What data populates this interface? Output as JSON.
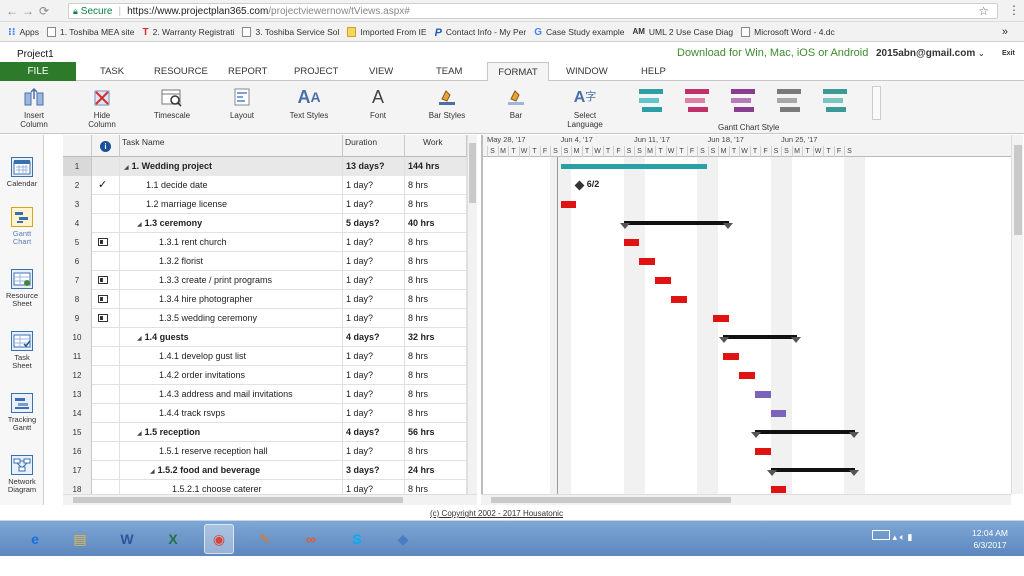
{
  "browser": {
    "secure_label": "Secure",
    "url_domain": "https://www.projectplan365.com",
    "url_path": "/projectviewernow/tViews.aspx#",
    "bookmarks": [
      {
        "label": "Apps",
        "icon": "apps-grid-icon"
      },
      {
        "label": "1. Toshiba MEA site",
        "icon": "page-icon"
      },
      {
        "label": "2. Warranty Registrati",
        "icon": "t-logo-icon"
      },
      {
        "label": "3. Toshiba Service Sol",
        "icon": "page-icon"
      },
      {
        "label": "Imported From IE",
        "icon": "folder-icon"
      },
      {
        "label": "Contact Info - My Per",
        "icon": "p-logo-icon"
      },
      {
        "label": "Case Study example",
        "icon": "google-icon"
      },
      {
        "label": "UML 2 Use Case Diag",
        "icon": "am-logo-icon"
      },
      {
        "label": "Microsoft Word - 4.dc",
        "icon": "page-icon"
      }
    ],
    "more_label": "»"
  },
  "app": {
    "project_title": "Project1",
    "download_text": "Download for Win, Mac, iOS or Android",
    "user_email": "2015abn@gmail.com",
    "exit_label": "Exit"
  },
  "menu": {
    "file": "FILE",
    "items": [
      "TASK",
      "RESOURCE",
      "REPORT",
      "PROJECT",
      "VIEW",
      "TEAM"
    ],
    "format": "FORMAT",
    "items2": [
      "WINDOW",
      "HELP"
    ]
  },
  "ribbon": {
    "buttons": [
      {
        "label": "Insert\nColumn",
        "icon": "insert-column-icon"
      },
      {
        "label": "Hide\nColumn",
        "icon": "hide-column-icon"
      },
      {
        "label": "Timescale",
        "icon": "timescale-icon"
      },
      {
        "label": "Layout",
        "icon": "layout-icon"
      },
      {
        "label": "Text Styles",
        "icon": "text-styles-icon"
      },
      {
        "label": "Font",
        "icon": "font-icon"
      },
      {
        "label": "Bar Styles",
        "icon": "bar-styles-icon"
      },
      {
        "label": "Bar",
        "icon": "bar-icon"
      },
      {
        "label": "Select\nLanguage",
        "icon": "language-icon"
      }
    ],
    "gantt_style_label": "Gantt Chart Style",
    "style_colors": [
      "#2aa0a6",
      "#c0306a",
      "#8a3c8e",
      "#7a7a7a",
      "#3a9a96"
    ]
  },
  "sidebar": [
    {
      "label": "Calendar",
      "icon": "calendar-icon"
    },
    {
      "label": "Gantt\nChart",
      "icon": "gantt-chart-icon"
    },
    {
      "label": "Resource\nSheet",
      "icon": "resource-sheet-icon"
    },
    {
      "label": "Task\nSheet",
      "icon": "task-sheet-icon"
    },
    {
      "label": "Tracking\nGantt",
      "icon": "tracking-gantt-icon"
    },
    {
      "label": "Network\nDiagram",
      "icon": "network-diagram-icon"
    }
  ],
  "grid": {
    "columns": {
      "info": "i",
      "name": "Task Name",
      "duration": "Duration",
      "work": "Work"
    },
    "rows": [
      {
        "id": "1",
        "name": "1. Wedding project",
        "duration": "13 days?",
        "work": "144 hrs",
        "level": 0,
        "summary": true,
        "indicator": ""
      },
      {
        "id": "2",
        "name": "1.1 decide date",
        "duration": "1 day?",
        "work": "8 hrs",
        "level": 1,
        "summary": false,
        "indicator": "check"
      },
      {
        "id": "3",
        "name": "1.2 marriage license",
        "duration": "1 day?",
        "work": "8 hrs",
        "level": 1,
        "summary": false,
        "indicator": ""
      },
      {
        "id": "4",
        "name": "1.3 ceremony",
        "duration": "5 days?",
        "work": "40 hrs",
        "level": 1,
        "summary": true,
        "indicator": ""
      },
      {
        "id": "5",
        "name": "1.3.1 rent church",
        "duration": "1 day?",
        "work": "8 hrs",
        "level": 2,
        "summary": false,
        "indicator": "note"
      },
      {
        "id": "6",
        "name": "1.3.2 florist",
        "duration": "1 day?",
        "work": "8 hrs",
        "level": 2,
        "summary": false,
        "indicator": ""
      },
      {
        "id": "7",
        "name": "1.3.3 create / print programs",
        "duration": "1 day?",
        "work": "8 hrs",
        "level": 2,
        "summary": false,
        "indicator": "note"
      },
      {
        "id": "8",
        "name": "1.3.4 hire photographer",
        "duration": "1 day?",
        "work": "8 hrs",
        "level": 2,
        "summary": false,
        "indicator": "note"
      },
      {
        "id": "9",
        "name": "1.3.5 wedding ceremony",
        "duration": "1 day?",
        "work": "8 hrs",
        "level": 2,
        "summary": false,
        "indicator": "note"
      },
      {
        "id": "10",
        "name": "1.4 guests",
        "duration": "4 days?",
        "work": "32 hrs",
        "level": 1,
        "summary": true,
        "indicator": ""
      },
      {
        "id": "11",
        "name": "1.4.1 develop gust list",
        "duration": "1 day?",
        "work": "8 hrs",
        "level": 2,
        "summary": false,
        "indicator": ""
      },
      {
        "id": "12",
        "name": "1.4.2 order invitations",
        "duration": "1 day?",
        "work": "8 hrs",
        "level": 2,
        "summary": false,
        "indicator": ""
      },
      {
        "id": "13",
        "name": "1.4.3 address and mail invitations",
        "duration": "1 day?",
        "work": "8 hrs",
        "level": 2,
        "summary": false,
        "indicator": ""
      },
      {
        "id": "14",
        "name": "1.4.4 track rsvps",
        "duration": "1 day?",
        "work": "8 hrs",
        "level": 2,
        "summary": false,
        "indicator": ""
      },
      {
        "id": "15",
        "name": "1.5 reception",
        "duration": "4 days?",
        "work": "56 hrs",
        "level": 1,
        "summary": true,
        "indicator": ""
      },
      {
        "id": "16",
        "name": "1.5.1 reserve reception hall",
        "duration": "1 day?",
        "work": "8 hrs",
        "level": 2,
        "summary": false,
        "indicator": ""
      },
      {
        "id": "17",
        "name": "1.5.2 food and beverage",
        "duration": "3 days?",
        "work": "24 hrs",
        "level": 2,
        "summary": true,
        "indicator": ""
      },
      {
        "id": "18",
        "name": "1.5.2.1 choose caterer",
        "duration": "1 day?",
        "work": "8 hrs",
        "level": 3,
        "summary": false,
        "indicator": ""
      }
    ]
  },
  "gantt": {
    "weeks": [
      "May 28, '17",
      "Jun 4, '17",
      "Jun 11, '17",
      "Jun 18, '17",
      "Jun 25, '17"
    ],
    "day_letters": [
      "S",
      "M",
      "T",
      "W",
      "T",
      "F",
      "S"
    ],
    "milestone_label": "6/2",
    "colors": {
      "task": "#e11212",
      "task_alt": "#7a63b8",
      "project_summary": "#2aa0a6",
      "summary": "#111111"
    }
  },
  "copyright": "(c) Copyright 2002 - 2017 Housatonic",
  "taskbar": {
    "apps": [
      {
        "icon": "internet-explorer-icon",
        "glyph": "e",
        "color": "#1e6fd9"
      },
      {
        "icon": "file-explorer-icon",
        "glyph": "▤",
        "color": "#e8b93a"
      },
      {
        "icon": "word-icon",
        "glyph": "W",
        "color": "#2b579a"
      },
      {
        "icon": "excel-icon",
        "glyph": "X",
        "color": "#217346"
      },
      {
        "icon": "chrome-icon",
        "glyph": "◉",
        "color": "#db4437"
      },
      {
        "icon": "paint-icon",
        "glyph": "✎",
        "color": "#d97b2a"
      },
      {
        "icon": "app-icon",
        "glyph": "∞",
        "color": "#e65a2b"
      },
      {
        "icon": "skype-icon",
        "glyph": "S",
        "color": "#00aff0"
      },
      {
        "icon": "app2-icon",
        "glyph": "◆",
        "color": "#4a7cc0"
      }
    ],
    "time": "12:04 AM",
    "date": "6/3/2017"
  }
}
